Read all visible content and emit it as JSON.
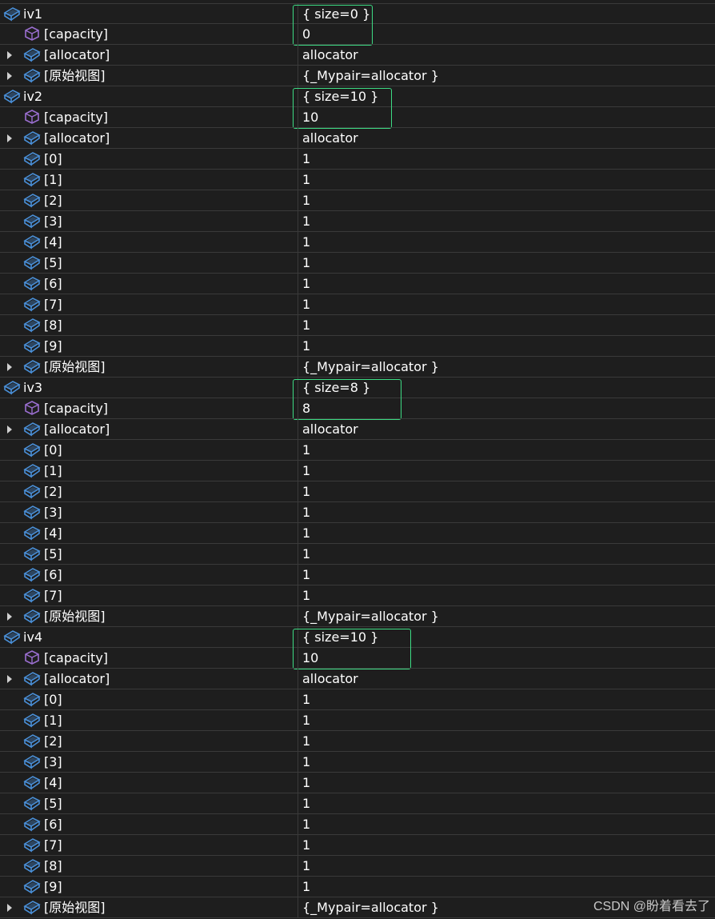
{
  "colors": {
    "background": "#1e1e1e",
    "grid_line": "#3a3a3a",
    "text": "#ffffff",
    "field_icon": "#4a90d9",
    "property_icon": "#9b6fd1",
    "highlight_box": "#3ddc84"
  },
  "rows": [
    {
      "level": 0,
      "icon": "field-icon",
      "expandable": false,
      "name": "iv1",
      "value": "{ size=0 }"
    },
    {
      "level": 1,
      "icon": "property-icon",
      "expandable": false,
      "name": "[capacity]",
      "value": "0"
    },
    {
      "level": 1,
      "icon": "field-icon",
      "expandable": true,
      "name": "[allocator]",
      "value": "allocator"
    },
    {
      "level": 1,
      "icon": "field-icon",
      "expandable": true,
      "name": "[原始视图]",
      "value": "{_Mypair=allocator }"
    },
    {
      "level": 0,
      "icon": "field-icon",
      "expandable": false,
      "name": "iv2",
      "value": "{ size=10 }"
    },
    {
      "level": 1,
      "icon": "property-icon",
      "expandable": false,
      "name": "[capacity]",
      "value": "10"
    },
    {
      "level": 1,
      "icon": "field-icon",
      "expandable": true,
      "name": "[allocator]",
      "value": "allocator"
    },
    {
      "level": 1,
      "icon": "field-icon",
      "expandable": false,
      "name": "[0]",
      "value": "1"
    },
    {
      "level": 1,
      "icon": "field-icon",
      "expandable": false,
      "name": "[1]",
      "value": "1"
    },
    {
      "level": 1,
      "icon": "field-icon",
      "expandable": false,
      "name": "[2]",
      "value": "1"
    },
    {
      "level": 1,
      "icon": "field-icon",
      "expandable": false,
      "name": "[3]",
      "value": "1"
    },
    {
      "level": 1,
      "icon": "field-icon",
      "expandable": false,
      "name": "[4]",
      "value": "1"
    },
    {
      "level": 1,
      "icon": "field-icon",
      "expandable": false,
      "name": "[5]",
      "value": "1"
    },
    {
      "level": 1,
      "icon": "field-icon",
      "expandable": false,
      "name": "[6]",
      "value": "1"
    },
    {
      "level": 1,
      "icon": "field-icon",
      "expandable": false,
      "name": "[7]",
      "value": "1"
    },
    {
      "level": 1,
      "icon": "field-icon",
      "expandable": false,
      "name": "[8]",
      "value": "1"
    },
    {
      "level": 1,
      "icon": "field-icon",
      "expandable": false,
      "name": "[9]",
      "value": "1"
    },
    {
      "level": 1,
      "icon": "field-icon",
      "expandable": true,
      "name": "[原始视图]",
      "value": "{_Mypair=allocator }"
    },
    {
      "level": 0,
      "icon": "field-icon",
      "expandable": false,
      "name": "iv3",
      "value": "{ size=8 }"
    },
    {
      "level": 1,
      "icon": "property-icon",
      "expandable": false,
      "name": "[capacity]",
      "value": "8"
    },
    {
      "level": 1,
      "icon": "field-icon",
      "expandable": true,
      "name": "[allocator]",
      "value": "allocator"
    },
    {
      "level": 1,
      "icon": "field-icon",
      "expandable": false,
      "name": "[0]",
      "value": "1"
    },
    {
      "level": 1,
      "icon": "field-icon",
      "expandable": false,
      "name": "[1]",
      "value": "1"
    },
    {
      "level": 1,
      "icon": "field-icon",
      "expandable": false,
      "name": "[2]",
      "value": "1"
    },
    {
      "level": 1,
      "icon": "field-icon",
      "expandable": false,
      "name": "[3]",
      "value": "1"
    },
    {
      "level": 1,
      "icon": "field-icon",
      "expandable": false,
      "name": "[4]",
      "value": "1"
    },
    {
      "level": 1,
      "icon": "field-icon",
      "expandable": false,
      "name": "[5]",
      "value": "1"
    },
    {
      "level": 1,
      "icon": "field-icon",
      "expandable": false,
      "name": "[6]",
      "value": "1"
    },
    {
      "level": 1,
      "icon": "field-icon",
      "expandable": false,
      "name": "[7]",
      "value": "1"
    },
    {
      "level": 1,
      "icon": "field-icon",
      "expandable": true,
      "name": "[原始视图]",
      "value": "{_Mypair=allocator }"
    },
    {
      "level": 0,
      "icon": "field-icon",
      "expandable": false,
      "name": "iv4",
      "value": "{ size=10 }"
    },
    {
      "level": 1,
      "icon": "property-icon",
      "expandable": false,
      "name": "[capacity]",
      "value": "10"
    },
    {
      "level": 1,
      "icon": "field-icon",
      "expandable": true,
      "name": "[allocator]",
      "value": "allocator"
    },
    {
      "level": 1,
      "icon": "field-icon",
      "expandable": false,
      "name": "[0]",
      "value": "1"
    },
    {
      "level": 1,
      "icon": "field-icon",
      "expandable": false,
      "name": "[1]",
      "value": "1"
    },
    {
      "level": 1,
      "icon": "field-icon",
      "expandable": false,
      "name": "[2]",
      "value": "1"
    },
    {
      "level": 1,
      "icon": "field-icon",
      "expandable": false,
      "name": "[3]",
      "value": "1"
    },
    {
      "level": 1,
      "icon": "field-icon",
      "expandable": false,
      "name": "[4]",
      "value": "1"
    },
    {
      "level": 1,
      "icon": "field-icon",
      "expandable": false,
      "name": "[5]",
      "value": "1"
    },
    {
      "level": 1,
      "icon": "field-icon",
      "expandable": false,
      "name": "[6]",
      "value": "1"
    },
    {
      "level": 1,
      "icon": "field-icon",
      "expandable": false,
      "name": "[7]",
      "value": "1"
    },
    {
      "level": 1,
      "icon": "field-icon",
      "expandable": false,
      "name": "[8]",
      "value": "1"
    },
    {
      "level": 1,
      "icon": "field-icon",
      "expandable": false,
      "name": "[9]",
      "value": "1"
    },
    {
      "level": 1,
      "icon": "field-icon",
      "expandable": true,
      "name": "[原始视图]",
      "value": "{_Mypair=allocator }"
    }
  ],
  "watermark": "CSDN @盼着看去了"
}
